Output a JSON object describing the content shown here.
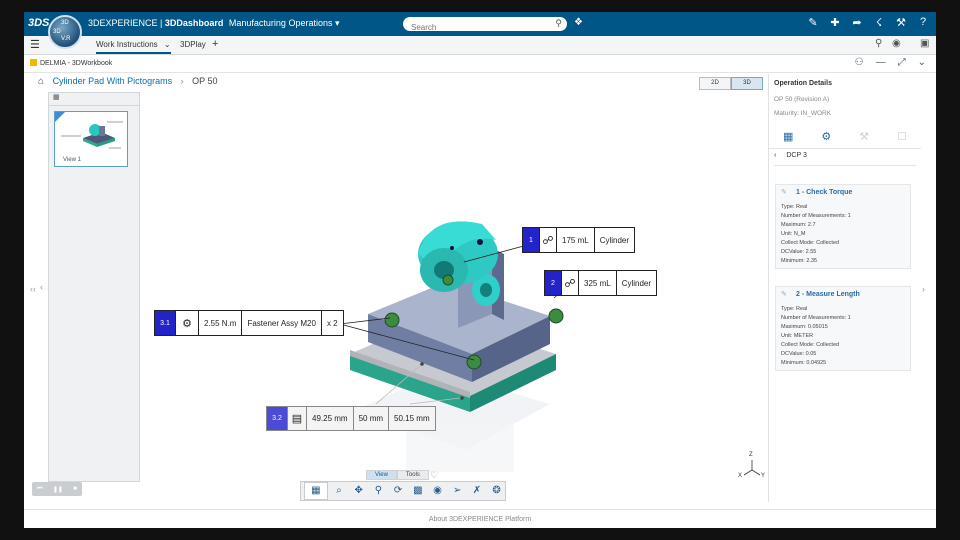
{
  "topbar": {
    "brand": "3DEXPERIENCE",
    "platform": "3DDashboard",
    "context": "Manufacturing Operations",
    "search_placeholder": "Search",
    "compass_labels": {
      "top": "3D",
      "right": "V.R",
      "left": "3D"
    }
  },
  "tabs": [
    {
      "label": "Work Instructions",
      "active": true
    },
    {
      "label": "3DPlay",
      "active": false
    }
  ],
  "workbook": {
    "app_label": "DELMIA - 3DWorkbook"
  },
  "breadcrumb": {
    "parent": "Cylinder Pad With Pictograms",
    "current": "OP 50"
  },
  "view_toggle": {
    "options": [
      "2D",
      "3D"
    ],
    "selected": "3D"
  },
  "thumbnail": {
    "label": "View 1"
  },
  "annotations": [
    {
      "num": "1",
      "value": "175 mL",
      "part": "Cylinder"
    },
    {
      "num": "2",
      "value": "325 mL",
      "part": "Cylinder"
    },
    {
      "num": "3.1",
      "value": "2.55 N.m",
      "part": "Fastener Assy M20",
      "qty": "x 2"
    },
    {
      "num": "3.2",
      "value": "49.25 mm",
      "mid": "50 mm",
      "max": "50.15 mm"
    }
  ],
  "viewer_tabs": [
    "View",
    "Tools"
  ],
  "details": {
    "title": "Operation Details",
    "revision": "OP 50 (Revision A)",
    "maturity": "Maturity: IN_WORK",
    "dcp": "DCP 3",
    "checks": [
      {
        "title": "1 - Check Torque",
        "rows": [
          "Type: Real",
          "Number of Measurements: 1",
          "Maximum: 2.7",
          "Unit: N_M",
          "Collect Mode: Collected",
          "DCValue: 2.55",
          "Minimum: 2.35"
        ]
      },
      {
        "title": "2 - Measure Length",
        "rows": [
          "Type: Real",
          "Number of Measurements: 1",
          "Maximum: 0.05015",
          "Unit: METER",
          "Collect Mode: Collected",
          "DCValue: 0.05",
          "Minimum: 0.04925"
        ]
      }
    ]
  },
  "axes": {
    "z": "Z",
    "x": "X",
    "y": "Y"
  },
  "footer": "About 3DEXPERIENCE Platform"
}
